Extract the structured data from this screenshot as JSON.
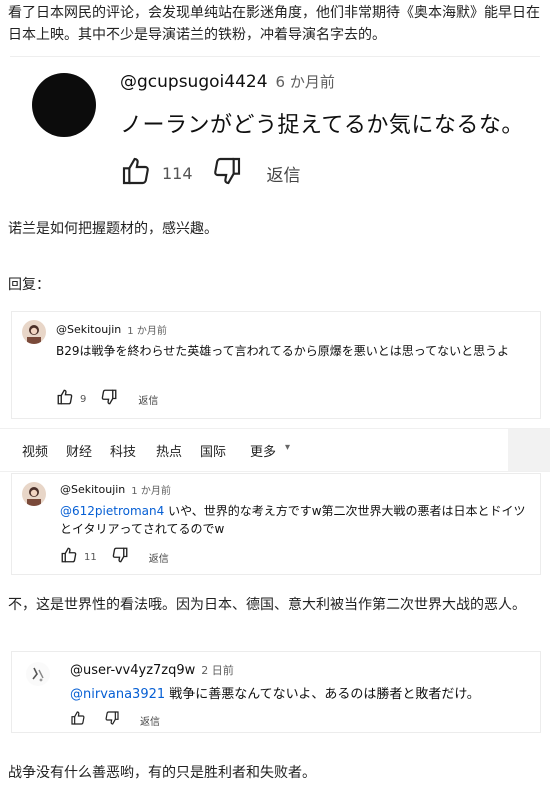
{
  "intro_text": "看了日本网民的评论，会发现单纯站在影迷角度，他们非常期待《奥本海默》能早日在日本上映。其中不少是导演诺兰的铁粉，冲着导演名字去的。",
  "comment1": {
    "user": "@gcupsugoi4424",
    "time": "6 か月前",
    "text": "ノーランがどう捉えてるか気になるな。",
    "likes": "114",
    "reply_label": "返信"
  },
  "caption1": "诺兰是如何把握题材的，感兴趣。",
  "reply_heading": "回复：",
  "comment2": {
    "user": "@Sekitoujin",
    "time": "1 か月前",
    "text": "B29は戦争を終わらせた英雄って言われてるから原爆を悪いとは思ってないと思うよ",
    "likes": "9",
    "reply_label": "返信"
  },
  "nav": {
    "items": [
      "视频",
      "财经",
      "科技",
      "热点",
      "国际",
      "更多"
    ]
  },
  "comment3": {
    "user": "@Sekitoujin",
    "time": "1 か月前",
    "mention": "@612pietroman4",
    "text": " いや、世界的な考え方ですw第二次世界大戦の悪者は日本とドイツとイタリアってされてるのでw",
    "likes": "11",
    "reply_label": "返信"
  },
  "caption3": "不，这是世界性的看法哦。因为日本、德国、意大利被当作第二次世界大战的恶人。",
  "comment4": {
    "user": "@user-vv4yz7zq9w",
    "time": "2 日前",
    "mention": "@nirvana3921",
    "text": " 戦争に善悪なんてないよ、あるのは勝者と敗者だけ。",
    "reply_label": "返信"
  },
  "caption4": "战争没有什么善恶哟，有的只是胜利者和失败者。",
  "colors": {
    "mention": "#065fd4",
    "text": "#0f0f0f",
    "meta": "#606060"
  },
  "icons": [
    "thumb-up-icon",
    "thumb-down-icon",
    "chevron-down-icon"
  ]
}
